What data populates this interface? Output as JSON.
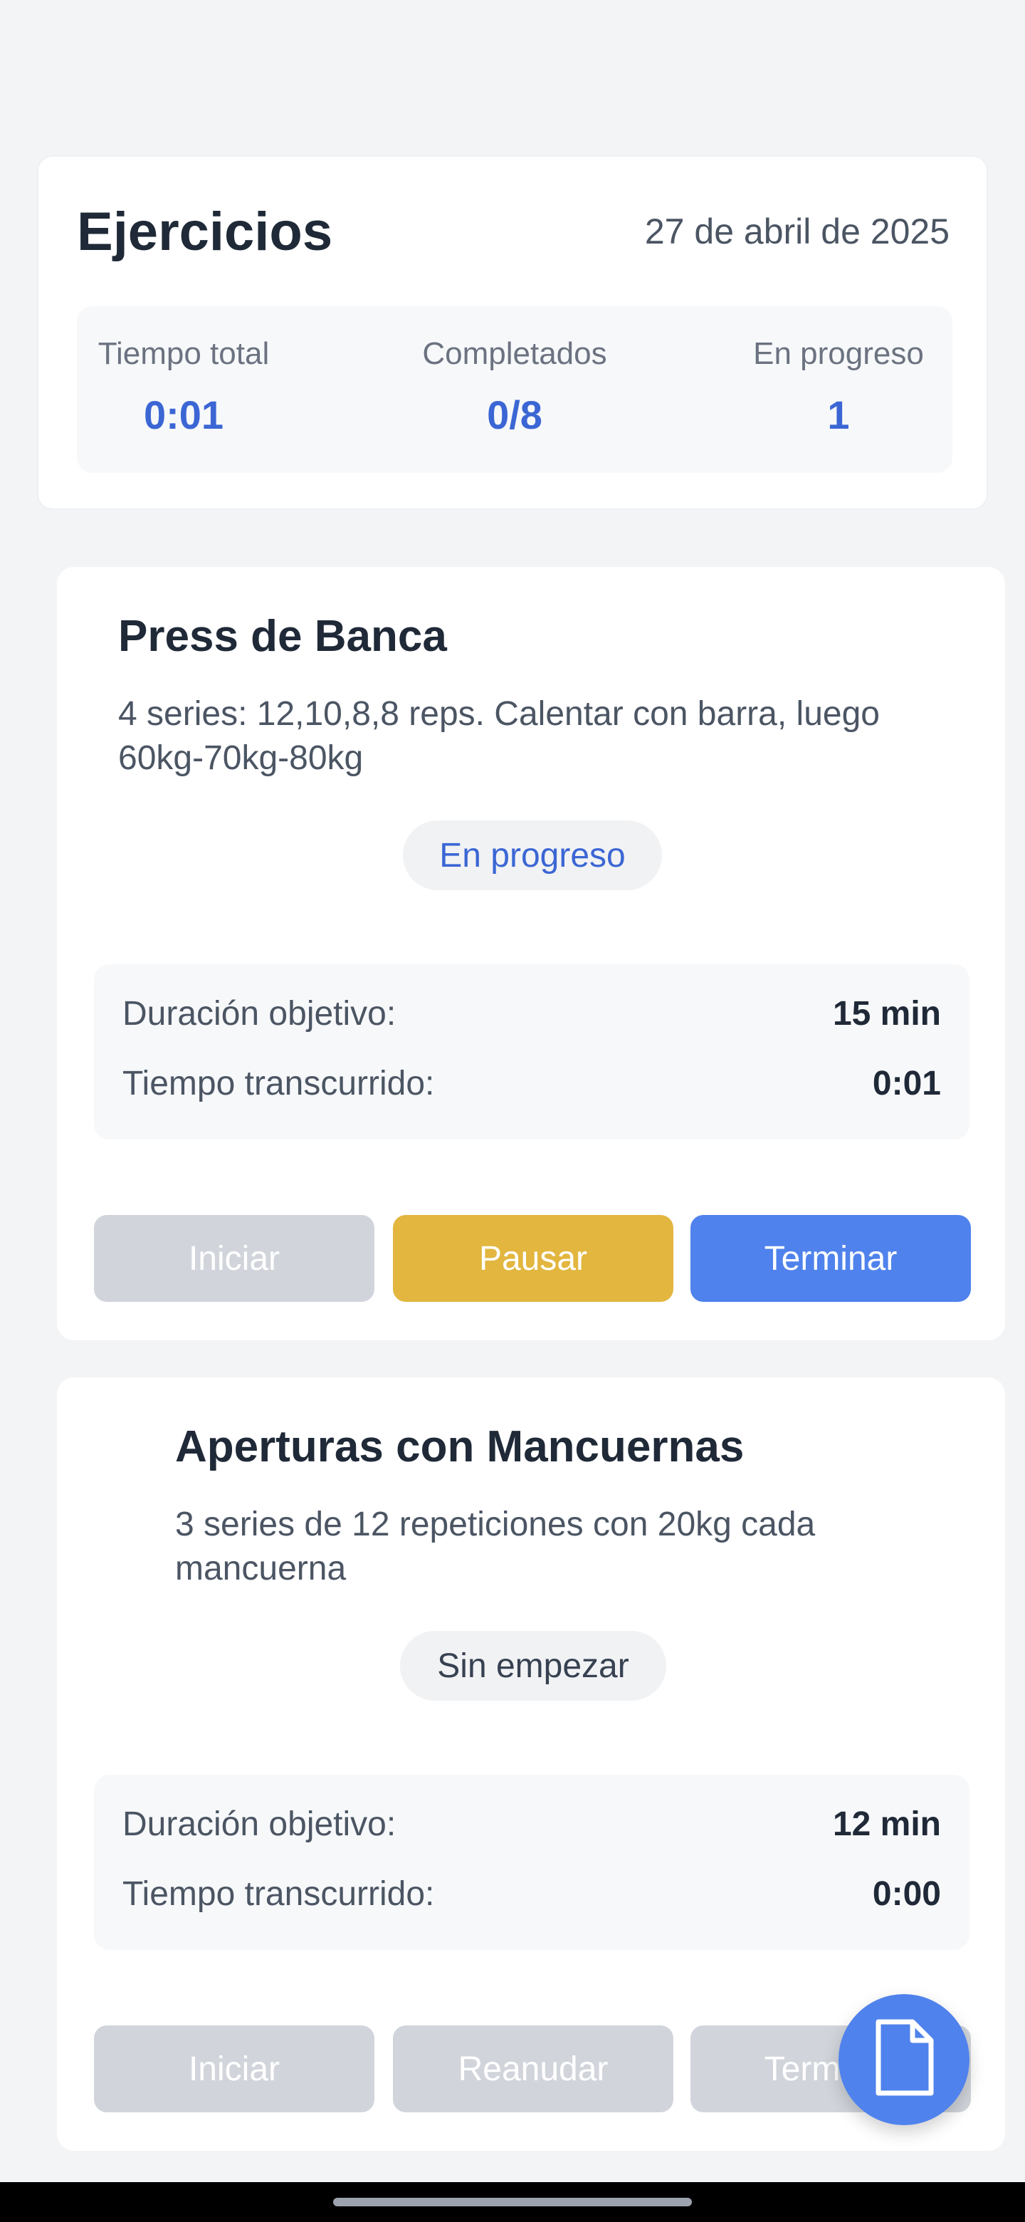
{
  "summary": {
    "title": "Ejercicios",
    "date": "27 de abril de 2025",
    "stats": [
      {
        "label": "Tiempo total",
        "value": "0:01"
      },
      {
        "label": "Completados",
        "value": "0/8"
      },
      {
        "label": "En progreso",
        "value": "1"
      }
    ]
  },
  "exercises": [
    {
      "title": "Press de Banca",
      "description": "4 series: 12,10,8,8 reps. Calentar con barra, luego 60kg-70kg-80kg",
      "status": "En progreso",
      "target_label": "Duración objetivo:",
      "target_value": "15 min",
      "elapsed_label": "Tiempo transcurrido:",
      "elapsed_value": "0:01",
      "buttons": [
        "Iniciar",
        "Pausar",
        "Terminar"
      ]
    },
    {
      "title": "Aperturas con Mancuernas",
      "description": "3 series de 12 repeticiones con 20kg cada mancuerna",
      "status": "Sin empezar",
      "target_label": "Duración objetivo:",
      "target_value": "12 min",
      "elapsed_label": "Tiempo transcurrido:",
      "elapsed_value": "0:00",
      "buttons": [
        "Iniciar",
        "Reanudar",
        "Terminar"
      ]
    }
  ],
  "fab": {
    "icon": "document-icon"
  },
  "colors": {
    "accent": "#3b66d4",
    "pause": "#e2b63f",
    "finish": "#4f82ec",
    "disabled": "#d1d5db"
  }
}
